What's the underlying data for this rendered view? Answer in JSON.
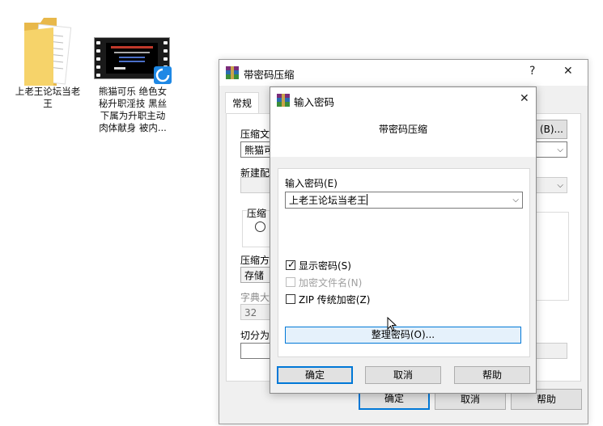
{
  "desktop": {
    "folder_label_line1": "上老王论坛当老",
    "folder_label_line2": "王",
    "video_label_line1": "熊猫可乐 绝色女",
    "video_label_line2": "秘升职淫技 黑丝",
    "video_label_line3": "下属为升职主动",
    "video_label_line4": "肉体献身 被内..."
  },
  "main_dialog": {
    "title": "带密码压缩",
    "help_glyph": "?",
    "close_glyph": "✕",
    "tab_general": "常规",
    "archive_name_label": "压缩文",
    "archive_name_value": "熊猫可",
    "browse_button": "(B)...",
    "new_profile_label": "新建配",
    "compress_group_label": "压缩",
    "compress_method_label": "压缩方",
    "compress_method_value": "存储",
    "dict_label": "字典大",
    "dict_value": "32",
    "split_label": "切分为",
    "ok_button": "确定",
    "cancel_button": "取消",
    "help_button": "帮助"
  },
  "password_dialog": {
    "title": "输入密码",
    "close_glyph": "✕",
    "header": "带密码压缩",
    "password_label": "输入密码(E)",
    "password_value": "上老王论坛当老王",
    "show_password_label": "显示密码(S)",
    "show_password_checked": true,
    "encrypt_names_label": "加密文件名(N)",
    "zip_legacy_label": "ZIP 传统加密(Z)",
    "organize_button": "整理密码(O)...",
    "ok_button": "确定",
    "cancel_button": "取消",
    "help_button": "帮助"
  }
}
